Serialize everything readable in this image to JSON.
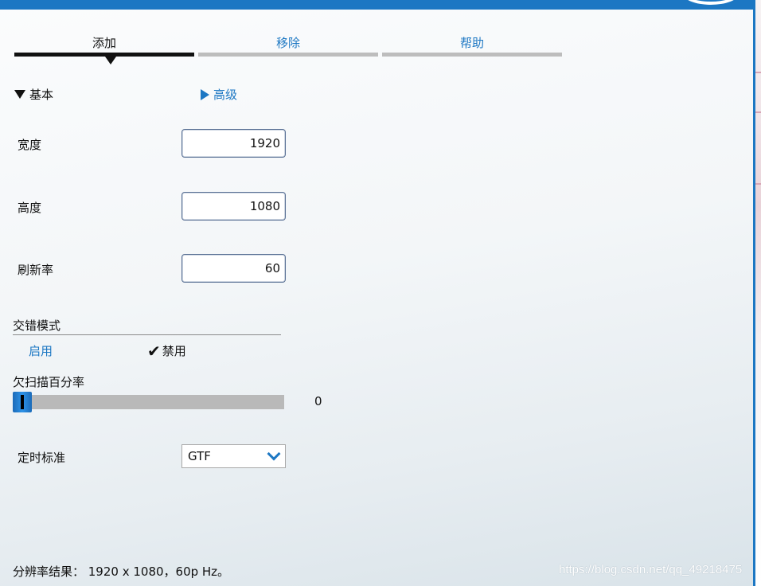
{
  "tabs": [
    {
      "label": "添加",
      "active": true
    },
    {
      "label": "移除",
      "active": false
    },
    {
      "label": "帮助",
      "active": false
    }
  ],
  "sections": {
    "basic_label": "基本",
    "advanced_label": "高级"
  },
  "fields": {
    "width": {
      "label": "宽度",
      "value": "1920"
    },
    "height": {
      "label": "高度",
      "value": "1080"
    },
    "refresh": {
      "label": "刷新率",
      "value": "60"
    }
  },
  "interlace": {
    "title": "交错模式",
    "enable_label": "启用",
    "disable_label": "禁用",
    "selected": "禁用"
  },
  "overscan": {
    "label": "欠扫描百分率",
    "value": "0"
  },
  "timing": {
    "label": "定时标准",
    "selected": "GTF"
  },
  "result_text": "分辨率结果： 1920 x 1080，60p Hz。",
  "watermark": "https://blog.csdn.net/qq_49218475",
  "colors": {
    "accent": "#1c77c3",
    "tab_inactive": "#bdbdbd",
    "tab_active": "#111111"
  },
  "icons": {
    "basic_toggle": "triangle-down-icon",
    "advanced_toggle": "triangle-right-icon",
    "checked": "checkmark-icon",
    "dropdown": "chevron-down-icon"
  }
}
